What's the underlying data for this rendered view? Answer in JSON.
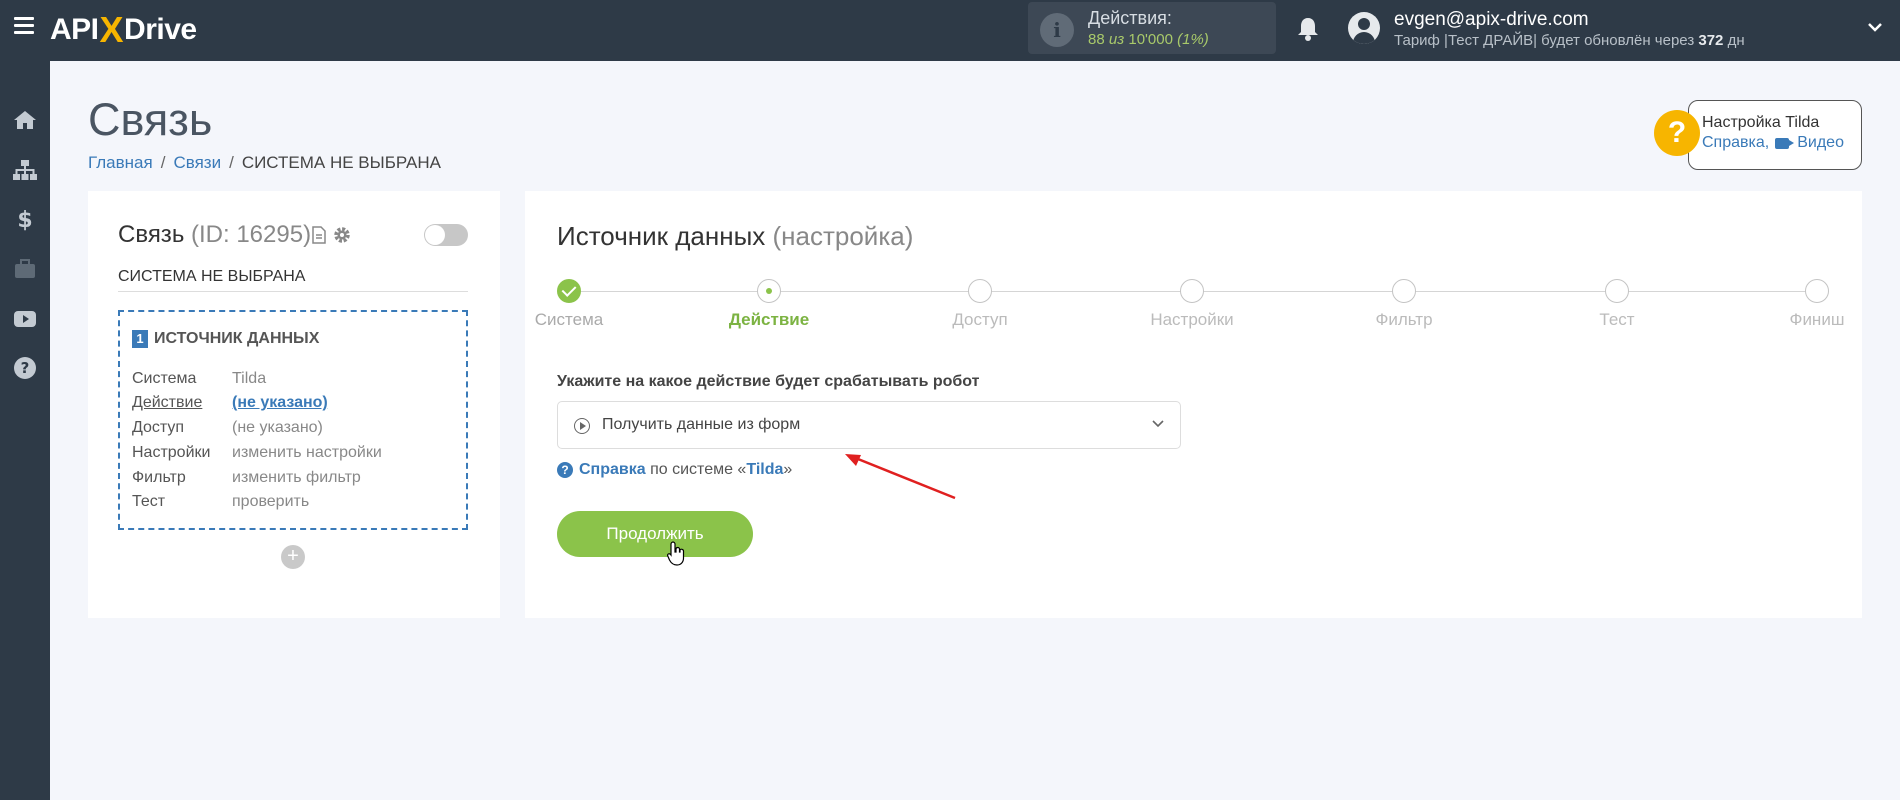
{
  "topbar": {
    "logo": {
      "left": "API",
      "x": "X",
      "right": "Drive"
    },
    "actions": {
      "title": "Действия:",
      "used": "88",
      "of_word": "из",
      "total": "10'000",
      "percent": "(1%)"
    },
    "user": {
      "email": "evgen@apix-drive.com",
      "plan_prefix": "Тариф |Тест ДРАЙВ| будет обновлён через",
      "plan_days": "372",
      "plan_suffix": "дн"
    }
  },
  "sidebar": {
    "items": [
      "home-icon",
      "sitemap-icon",
      "dollar-icon",
      "briefcase-icon",
      "youtube-icon",
      "help-icon"
    ]
  },
  "page": {
    "title": "Связь",
    "breadcrumb": {
      "home": "Главная",
      "connections": "Связи",
      "current": "СИСТЕМА НЕ ВЫБРАНА"
    }
  },
  "help_widget": {
    "title": "Настройка Tilda",
    "help_link": "Справка,",
    "video_link": "Видео"
  },
  "left_card": {
    "title": "Связь",
    "id_text": "(ID: 16295)",
    "connection_name": "СИСТЕМА НЕ ВЫБРАНА",
    "source": {
      "number": "1",
      "heading": "ИСТОЧНИК ДАННЫХ",
      "rows": [
        {
          "key": "Система",
          "value": "Tilda"
        },
        {
          "key": "Действие",
          "value": "(не указано)"
        },
        {
          "key": "Доступ",
          "value": "(не указано)"
        },
        {
          "key": "Настройки",
          "value": "изменить настройки"
        },
        {
          "key": "Фильтр",
          "value": "изменить фильтр"
        },
        {
          "key": "Тест",
          "value": "проверить"
        }
      ]
    },
    "add_label": "+"
  },
  "right_card": {
    "title": "Источник данных",
    "title_note": "(настройка)",
    "steps": [
      {
        "label": "Система",
        "state": "done"
      },
      {
        "label": "Действие",
        "state": "current"
      },
      {
        "label": "Доступ",
        "state": "todo"
      },
      {
        "label": "Настройки",
        "state": "todo"
      },
      {
        "label": "Фильтр",
        "state": "todo"
      },
      {
        "label": "Тест",
        "state": "todo"
      },
      {
        "label": "Финиш",
        "state": "todo"
      }
    ],
    "field_label": "Укажите на какое действие будет срабатывать робот",
    "selected_action": "Получить данные из форм",
    "help": {
      "link": "Справка",
      "middle": "по системе «",
      "system": "Tilda",
      "end": "»"
    },
    "continue_button": "Продолжить"
  },
  "colors": {
    "topbar": "#2e3a47",
    "accent_green": "#8bc34a",
    "link_blue": "#3a7ab8",
    "brand_yellow": "#f7b500",
    "annotation_red": "#e02020"
  }
}
